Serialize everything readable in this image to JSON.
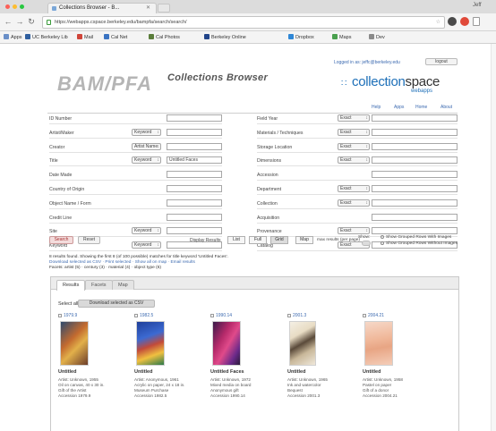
{
  "browser": {
    "tab_title": "Collections Browser - B...",
    "user_badge": "Jeff",
    "url": "https://webapps.cspace.berkeley.edu/bampfa/search/search/",
    "bookmarks": [
      {
        "label": "Apps",
        "color": "#6a8fc8"
      },
      {
        "label": "UC Berkeley Lib",
        "color": "#2f5f9f"
      },
      {
        "label": "Mail",
        "color": "#d0453a"
      },
      {
        "label": "Cal Net",
        "color": "#3a73c2"
      },
      {
        "label": "Cal Photos",
        "color": "#5a7d3a"
      },
      {
        "label": "Berkeley Online",
        "color": "#22458a"
      },
      {
        "label": "Dropbox",
        "color": "#2f87d6"
      },
      {
        "label": "Maps",
        "color": "#49a04e"
      },
      {
        "label": "Dev",
        "color": "#8a8a8a"
      }
    ]
  },
  "header": {
    "logo": "BAM/PFA",
    "title": "Collections Browser",
    "brand": "collection",
    "brand_bold": "space",
    "brand_sub": "webapps",
    "top_link": "Logged in as: jeffc@berkeley.edu",
    "logout": "logout",
    "links": [
      "Help",
      "Apps",
      "Home",
      "About"
    ]
  },
  "form": {
    "left_fields": [
      {
        "label": "ID Number",
        "select": "",
        "value": ""
      },
      {
        "label": "Artist/Maker",
        "select": "Keyword",
        "value": ""
      },
      {
        "label": "Creator",
        "select": "Artist Name",
        "value": ""
      },
      {
        "label": "Title",
        "select": "Keyword",
        "value": "Untitled Faces"
      },
      {
        "label": "Date Made",
        "select": "",
        "value": ""
      },
      {
        "label": "Country of Origin",
        "select": "",
        "value": ""
      },
      {
        "label": "Object Name / Form",
        "select": "",
        "value": ""
      },
      {
        "label": "Credit Line",
        "select": "",
        "value": ""
      },
      {
        "label": "Site",
        "select": "Keyword",
        "value": ""
      },
      {
        "label": "Keyword",
        "select": "Keyword",
        "value": ""
      }
    ],
    "right_fields": [
      {
        "label": "Field Year",
        "select": "Exact",
        "value": ""
      },
      {
        "label": "Materials / Techniques",
        "select": "Exact",
        "value": ""
      },
      {
        "label": "Storage Location",
        "select": "Exact",
        "value": ""
      },
      {
        "label": "Dimensions",
        "select": "Exact",
        "value": ""
      },
      {
        "label": "Accession",
        "select": "",
        "value": ""
      },
      {
        "label": "Department",
        "select": "Exact",
        "value": ""
      },
      {
        "label": "Collection",
        "select": "Exact",
        "value": ""
      },
      {
        "label": "Acquisition",
        "select": "",
        "value": ""
      },
      {
        "label": "Provenance",
        "select": "Exact",
        "value": ""
      },
      {
        "label": "Catalog",
        "select": "Exact",
        "value": ""
      }
    ],
    "search_button": "Search",
    "reset_button": "Reset",
    "display_label": "Display Results",
    "segments": [
      "List",
      "Full",
      "Grid",
      "Map"
    ],
    "active_segment": "Grid",
    "maxresults_label": "max results (per page)",
    "toggle_label": "Show:",
    "radio1": "Show Grouped Rows With Images",
    "radio2": "Show Grouped Rows Without Images"
  },
  "status": {
    "line1": "8 results found. Showing the first 8 (of 100 possible) matches for title keyword 'Untitled Faces'.",
    "line2": "Download selected as CSV · Print selected · Show all on map · Email results",
    "line3": "Facets: artist (5) · century (3) · material (4) · object type (6)"
  },
  "results": {
    "tabs": [
      "Results",
      "Facets",
      "Map"
    ],
    "active_tab": "Results",
    "select_label": "Select all:",
    "select_button": "Download selected as CSV",
    "cards": [
      {
        "check": "1979.9",
        "title": "Untitled",
        "desc": [
          "Artist: Unknown, 1955",
          "Oil on canvas, 40 x 30 in.",
          "Gift of the Artist",
          "Accession 1979.9"
        ],
        "thumb": "linear-gradient(135deg,#2d4a6e,#c36a2f 40%,#e2b04a 60%,#6c3d2a)"
      },
      {
        "check": "1982.5",
        "title": "Untitled",
        "desc": [
          "Artist: Anonymous, 1961",
          "Acrylic on paper, 24 x 18 in.",
          "Museum Purchase",
          "Accession 1982.5"
        ],
        "thumb": "linear-gradient(160deg,#1f3f9a,#3c6ad2 35%,#c24a3a 55%,#f0c040 75%,#2b7a4a)"
      },
      {
        "check": "1990.14",
        "title": "Untitled Faces",
        "desc": [
          "Artist: Unknown, 1972",
          "Mixed media on board",
          "Anonymous gift",
          "Accession 1990.14"
        ],
        "thumb": "linear-gradient(120deg,#3a1a4a,#b52a6a 35%,#e04a8a 55%,#6a2a8a 80%,#2a1a3a)"
      },
      {
        "check": "2001.3",
        "title": "Untitled",
        "desc": [
          "Artist: Unknown, 1965",
          "Ink and watercolor",
          "Bequest",
          "Accession 2001.3"
        ],
        "thumb": "linear-gradient(150deg,#f4efe4,#e8dcc4 30%,#5a4a3a 50%,#c9b89a 70%,#efe8da)"
      },
      {
        "check": "2004.21",
        "title": "Untitled",
        "desc": [
          "Artist: Unknown, 1958",
          "Pastel on paper",
          "Gift of a donor",
          "Accession 2004.21"
        ],
        "thumb": "linear-gradient(170deg,#f6d8c8,#f0b89a 40%,#e8a584 60%,#f4cdb8)"
      }
    ]
  }
}
